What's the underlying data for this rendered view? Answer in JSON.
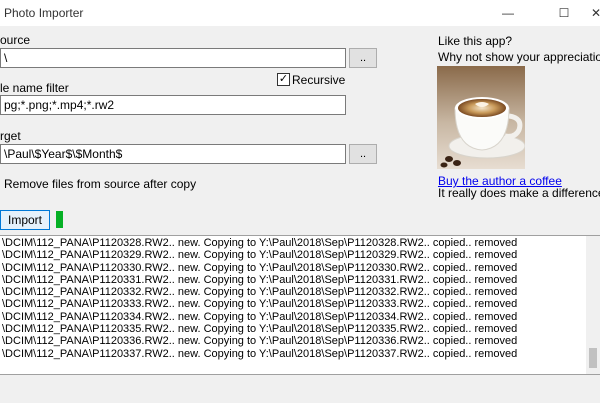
{
  "window": {
    "title": "Photo Importer",
    "controls": {
      "minimize": "—",
      "maximize": "☐",
      "close": "✕"
    }
  },
  "source": {
    "label": "ource",
    "value": "\\",
    "browse_label": ".."
  },
  "filter": {
    "label": "le name filter",
    "value": "pg;*.png;*.mp4;*.rw2"
  },
  "recursive": {
    "label": "Recursive",
    "checked": true,
    "check_mark": "✓"
  },
  "target": {
    "label": "rget",
    "value": "\\Paul\\$Year$\\$Month$",
    "browse_label": ".."
  },
  "remove_option": {
    "label": "Remove files from source after copy"
  },
  "promo": {
    "heading": "Like this app?",
    "subheading": "Why not show your appreciation?",
    "link": "Buy the author a coffee",
    "note": "It really does make a difference"
  },
  "import": {
    "button_label": "Import",
    "progress_color": "#06b025"
  },
  "log": {
    "lines": [
      "\\DCIM\\112_PANA\\P1120328.RW2.. new. Copying to Y:\\Paul\\2018\\Sep\\P1120328.RW2.. copied.. removed",
      "\\DCIM\\112_PANA\\P1120329.RW2.. new. Copying to Y:\\Paul\\2018\\Sep\\P1120329.RW2.. copied.. removed",
      "\\DCIM\\112_PANA\\P1120330.RW2.. new. Copying to Y:\\Paul\\2018\\Sep\\P1120330.RW2.. copied.. removed",
      "\\DCIM\\112_PANA\\P1120331.RW2.. new. Copying to Y:\\Paul\\2018\\Sep\\P1120331.RW2.. copied.. removed",
      "\\DCIM\\112_PANA\\P1120332.RW2.. new. Copying to Y:\\Paul\\2018\\Sep\\P1120332.RW2.. copied.. removed",
      "\\DCIM\\112_PANA\\P1120333.RW2.. new. Copying to Y:\\Paul\\2018\\Sep\\P1120333.RW2.. copied.. removed",
      "\\DCIM\\112_PANA\\P1120334.RW2.. new. Copying to Y:\\Paul\\2018\\Sep\\P1120334.RW2.. copied.. removed",
      "\\DCIM\\112_PANA\\P1120335.RW2.. new. Copying to Y:\\Paul\\2018\\Sep\\P1120335.RW2.. copied.. removed",
      "\\DCIM\\112_PANA\\P1120336.RW2.. new. Copying to Y:\\Paul\\2018\\Sep\\P1120336.RW2.. copied.. removed",
      "\\DCIM\\112_PANA\\P1120337.RW2.. new. Copying to Y:\\Paul\\2018\\Sep\\P1120337.RW2.. copied.. removed"
    ]
  },
  "colors": {
    "accent": "#0078d7",
    "link": "#0000ee"
  }
}
